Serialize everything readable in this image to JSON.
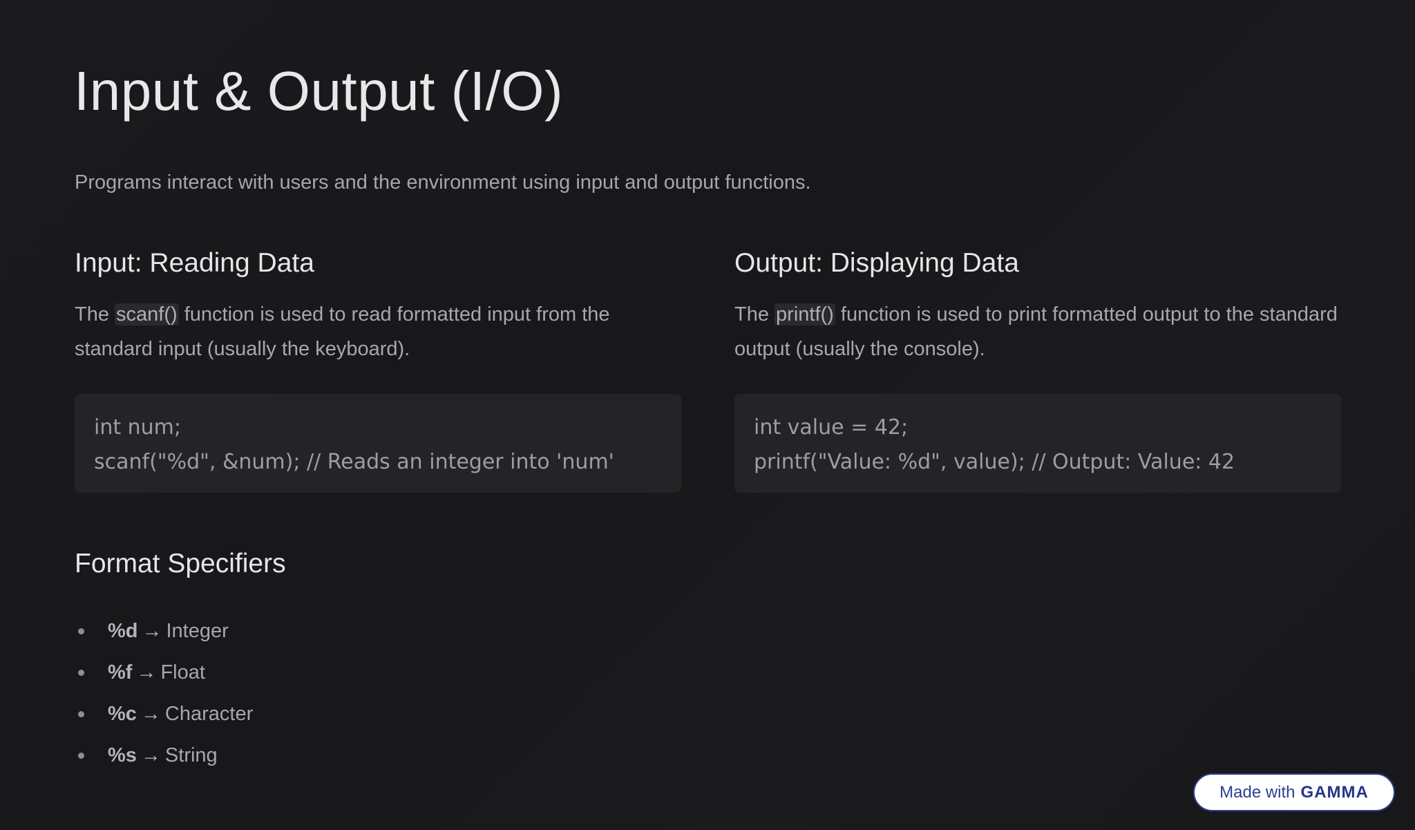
{
  "slide": {
    "title": "Input & Output (I/O)",
    "subtitle": "Programs interact with users and the environment using input and output functions."
  },
  "input_section": {
    "heading": "Input: Reading Data",
    "text_before": "The ",
    "inline_code": "scanf()",
    "text_after": " function is used to read formatted input from the standard input (usually the keyboard).",
    "code_lines": [
      "int num;",
      "scanf(\"%d\", &num); // Reads an integer into 'num'"
    ]
  },
  "output_section": {
    "heading": "Output: Displaying Data",
    "text_before": "The ",
    "inline_code": "printf()",
    "text_after": " function is used to print formatted output to the standard output (usually the console).",
    "code_lines": [
      "int value = 42;",
      "printf(\"Value: %d\", value); // Output: Value: 42"
    ]
  },
  "format_specifiers": {
    "heading": "Format Specifiers",
    "arrow": "→",
    "items": [
      {
        "spec": "%d",
        "meaning": "Integer"
      },
      {
        "spec": "%f",
        "meaning": "Float"
      },
      {
        "spec": "%c",
        "meaning": "Character"
      },
      {
        "spec": "%s",
        "meaning": "String"
      }
    ]
  },
  "badge": {
    "prefix": "Made with",
    "brand": "GAMMA"
  },
  "colors": {
    "background": "#19191b",
    "code_background": "#242426",
    "badge_border": "#2f3f95"
  }
}
